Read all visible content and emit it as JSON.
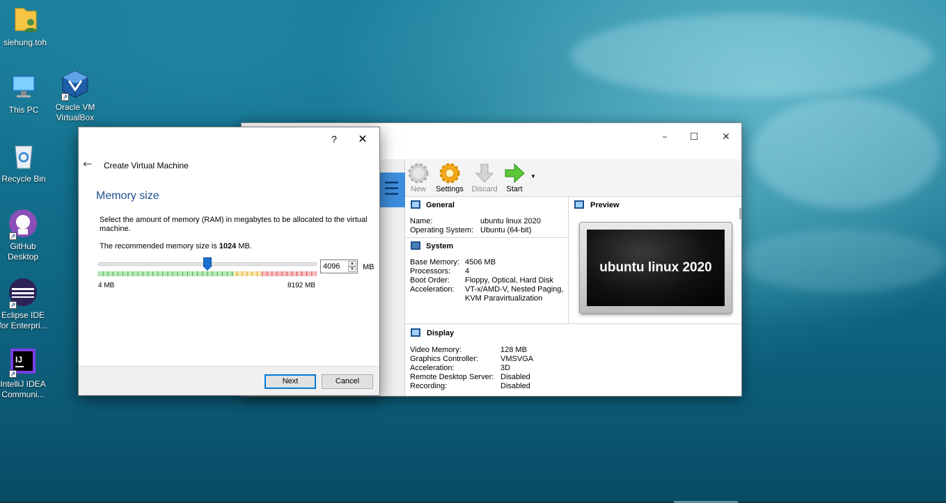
{
  "desktop": {
    "icons": [
      {
        "label": "siehung.toh"
      },
      {
        "label": "This PC"
      },
      {
        "label": "Oracle VM VirtualBox"
      },
      {
        "label": "Recycle Bin"
      },
      {
        "label": "GitHub Desktop"
      },
      {
        "label": "Eclipse IDE for Enterpri..."
      },
      {
        "label": "IntelliJ IDEA Communi..."
      }
    ]
  },
  "vbox": {
    "toolbar": {
      "new": "New",
      "settings": "Settings",
      "discard": "Discard",
      "start": "Start"
    },
    "general": {
      "title": "General",
      "name_label": "Name:",
      "name_value": "ubuntu linux 2020",
      "os_label": "Operating System:",
      "os_value": "Ubuntu (64-bit)"
    },
    "system": {
      "title": "System",
      "mem_label": "Base Memory:",
      "mem_value": "4506 MB",
      "proc_label": "Processors:",
      "proc_value": "4",
      "boot_label": "Boot Order:",
      "boot_value": "Floppy, Optical, Hard Disk",
      "accel_label": "Acceleration:",
      "accel_value_1": "VT-x/AMD-V, Nested Paging,",
      "accel_value_2": "KVM Paravirtualization"
    },
    "preview": {
      "title": "Preview",
      "screen_text": "ubuntu linux 2020"
    },
    "display": {
      "title": "Display",
      "vmem_label": "Video Memory:",
      "vmem_value": "128 MB",
      "gc_label": "Graphics Controller:",
      "gc_value": "VMSVGA",
      "accel_label": "Acceleration:",
      "accel_value": "3D",
      "rds_label": "Remote Desktop Server:",
      "rds_value": "Disabled",
      "rec_label": "Recording:",
      "rec_value": "Disabled"
    }
  },
  "dialog": {
    "help": "?",
    "wizard_title": "Create Virtual Machine",
    "page_title": "Memory size",
    "description": "Select the amount of memory (RAM) in megabytes to be allocated to the virtual machine.",
    "recommend_prefix": "The recommended memory size is ",
    "recommend_value": "1024",
    "recommend_suffix": " MB.",
    "memory_value": "4096",
    "memory_min": 4,
    "memory_max": 8192,
    "slider_min_label": "4 MB",
    "slider_max_label": "8192 MB",
    "unit": "MB",
    "next_label": "Next",
    "cancel_label": "Cancel",
    "colors": {
      "safe": "#7ed67e",
      "warn": "#f2d26b",
      "danger": "#f08a8a"
    }
  }
}
